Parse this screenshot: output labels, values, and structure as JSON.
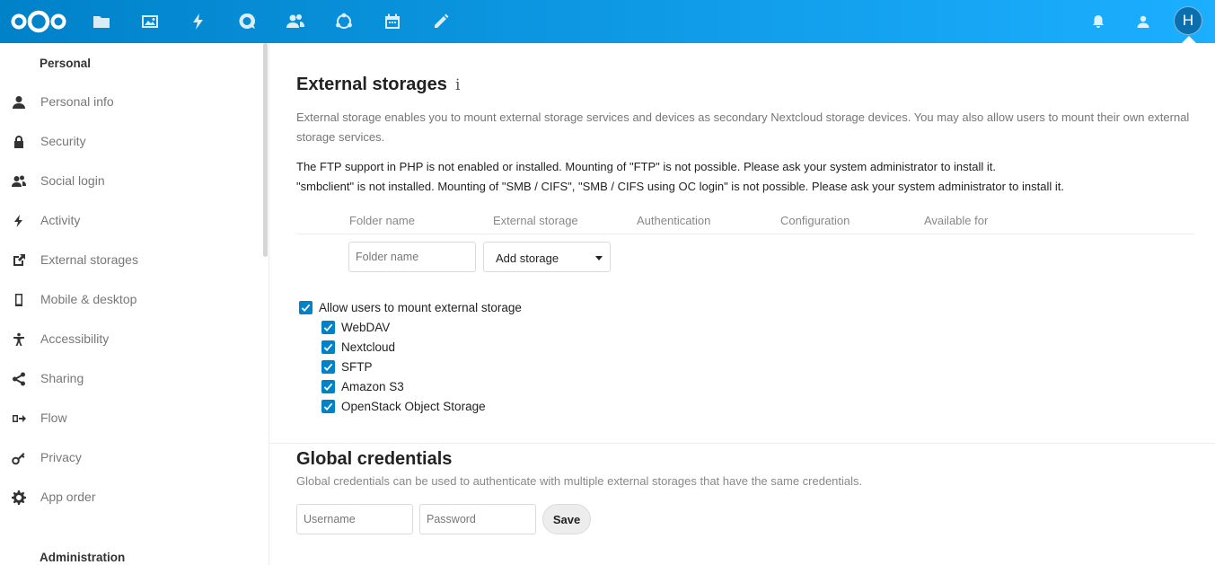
{
  "header": {
    "apps": [
      {
        "name": "files-icon"
      },
      {
        "name": "photos-icon"
      },
      {
        "name": "activity-icon"
      },
      {
        "name": "talk-icon"
      },
      {
        "name": "contacts-icon"
      },
      {
        "name": "circles-icon"
      },
      {
        "name": "calendar-icon"
      },
      {
        "name": "notes-icon"
      }
    ],
    "avatar_initial": "H",
    "accent_colors": [
      "#0082c9",
      "#1cafff"
    ]
  },
  "sidebar": {
    "personal_title": "Personal",
    "items": [
      {
        "label": "Personal info",
        "icon": "user-icon"
      },
      {
        "label": "Security",
        "icon": "lock-icon"
      },
      {
        "label": "Social login",
        "icon": "group-icon"
      },
      {
        "label": "Activity",
        "icon": "activity-icon"
      },
      {
        "label": "External storages",
        "icon": "external-link-icon"
      },
      {
        "label": "Mobile & desktop",
        "icon": "phone-icon"
      },
      {
        "label": "Accessibility",
        "icon": "accessibility-icon"
      },
      {
        "label": "Sharing",
        "icon": "share-icon"
      },
      {
        "label": "Flow",
        "icon": "flow-icon"
      },
      {
        "label": "Privacy",
        "icon": "key-icon"
      },
      {
        "label": "App order",
        "icon": "gear-icon"
      }
    ],
    "admin_title": "Administration"
  },
  "main": {
    "title": "External storages",
    "info_glyph": "i",
    "description": "External storage enables you to mount external storage services and devices as secondary Nextcloud storage devices. You may also allow users to mount their own external storage services.",
    "warnings": [
      "The FTP support in PHP is not enabled or installed. Mounting of \"FTP\" is not possible. Please ask your system administrator to install it.",
      "\"smbclient\" is not installed. Mounting of \"SMB / CIFS\", \"SMB / CIFS using OC login\" is not possible. Please ask your system administrator to install it."
    ],
    "table_headers": [
      "Folder name",
      "External storage",
      "Authentication",
      "Configuration",
      "Available for"
    ],
    "folder_placeholder": "Folder name",
    "add_storage_label": "Add storage",
    "allow_mount_label": "Allow users to mount external storage",
    "backends": [
      "WebDAV",
      "Nextcloud",
      "SFTP",
      "Amazon S3",
      "OpenStack Object Storage"
    ]
  },
  "global": {
    "title": "Global credentials",
    "description": "Global credentials can be used to authenticate with multiple external storages that have the same credentials.",
    "username_placeholder": "Username",
    "password_placeholder": "Password",
    "save_label": "Save"
  }
}
